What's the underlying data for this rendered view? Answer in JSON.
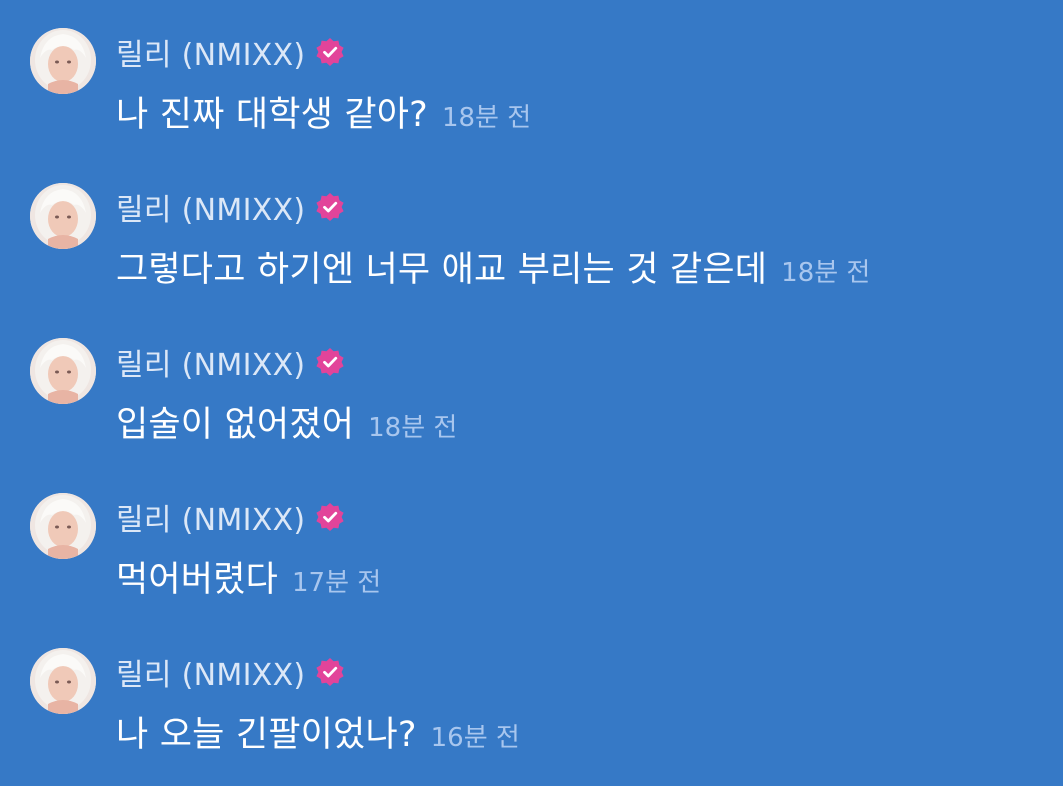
{
  "colors": {
    "background": "#3679c6",
    "sender_name": "#dbe7f7",
    "message_text": "#ffffff",
    "timestamp": "#a8c6ee",
    "verified_badge": "#e2449a"
  },
  "messages": [
    {
      "sender": "릴리 (NMIXX)",
      "text": "나 진짜 대학생 같아?",
      "time": "18분 전",
      "avatar_icon": "profile-photo",
      "badge_icon": "verified-check-icon"
    },
    {
      "sender": "릴리 (NMIXX)",
      "text": "그렇다고 하기엔 너무 애교 부리는 것 같은데",
      "time": "18분 전",
      "avatar_icon": "profile-photo",
      "badge_icon": "verified-check-icon"
    },
    {
      "sender": "릴리 (NMIXX)",
      "text": "입술이 없어졌어",
      "time": "18분 전",
      "avatar_icon": "profile-photo",
      "badge_icon": "verified-check-icon"
    },
    {
      "sender": "릴리 (NMIXX)",
      "text": "먹어버렸다",
      "time": "17분 전",
      "avatar_icon": "profile-photo",
      "badge_icon": "verified-check-icon"
    },
    {
      "sender": "릴리 (NMIXX)",
      "text": "나 오늘 긴팔이었나?",
      "time": "16분 전",
      "avatar_icon": "profile-photo",
      "badge_icon": "verified-check-icon"
    }
  ]
}
